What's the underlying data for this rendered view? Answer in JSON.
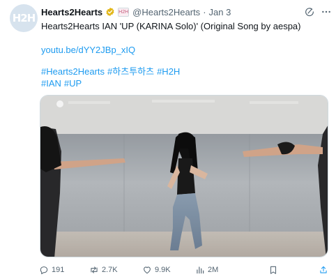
{
  "tweet": {
    "avatar_text": "H2H",
    "display_name": "Hearts2Hearts",
    "affiliate_badge_text": "H2H",
    "handle": "@Hearts2Hearts",
    "separator": "·",
    "date": "Jan 3",
    "text_line": "Hearts2Hearts IAN 'UP (KARINA Solo)' (Original Song by aespa)",
    "link": "youtu.be/dYY2JBp_xIQ",
    "hashtags_line1": [
      "#Hearts2Hearts",
      "#하츠투하츠",
      "#H2H"
    ],
    "hashtags_line2": [
      "#IAN",
      "#UP"
    ]
  },
  "stats": {
    "replies": "191",
    "reposts": "2.7K",
    "likes": "9.9K",
    "views": "2M"
  },
  "icons": {
    "verified": "verified-badge-icon",
    "grok": "grok-icon",
    "more": "more-icon",
    "reply": "reply-icon",
    "repost": "repost-icon",
    "like": "like-icon",
    "views": "views-icon",
    "bookmark": "bookmark-icon",
    "share": "share-icon"
  },
  "colors": {
    "text": "#0f1419",
    "muted": "#536471",
    "link": "#1d9bf0",
    "verified_gold": "#e2b719",
    "avatar_bg": "#d7e3ee"
  }
}
